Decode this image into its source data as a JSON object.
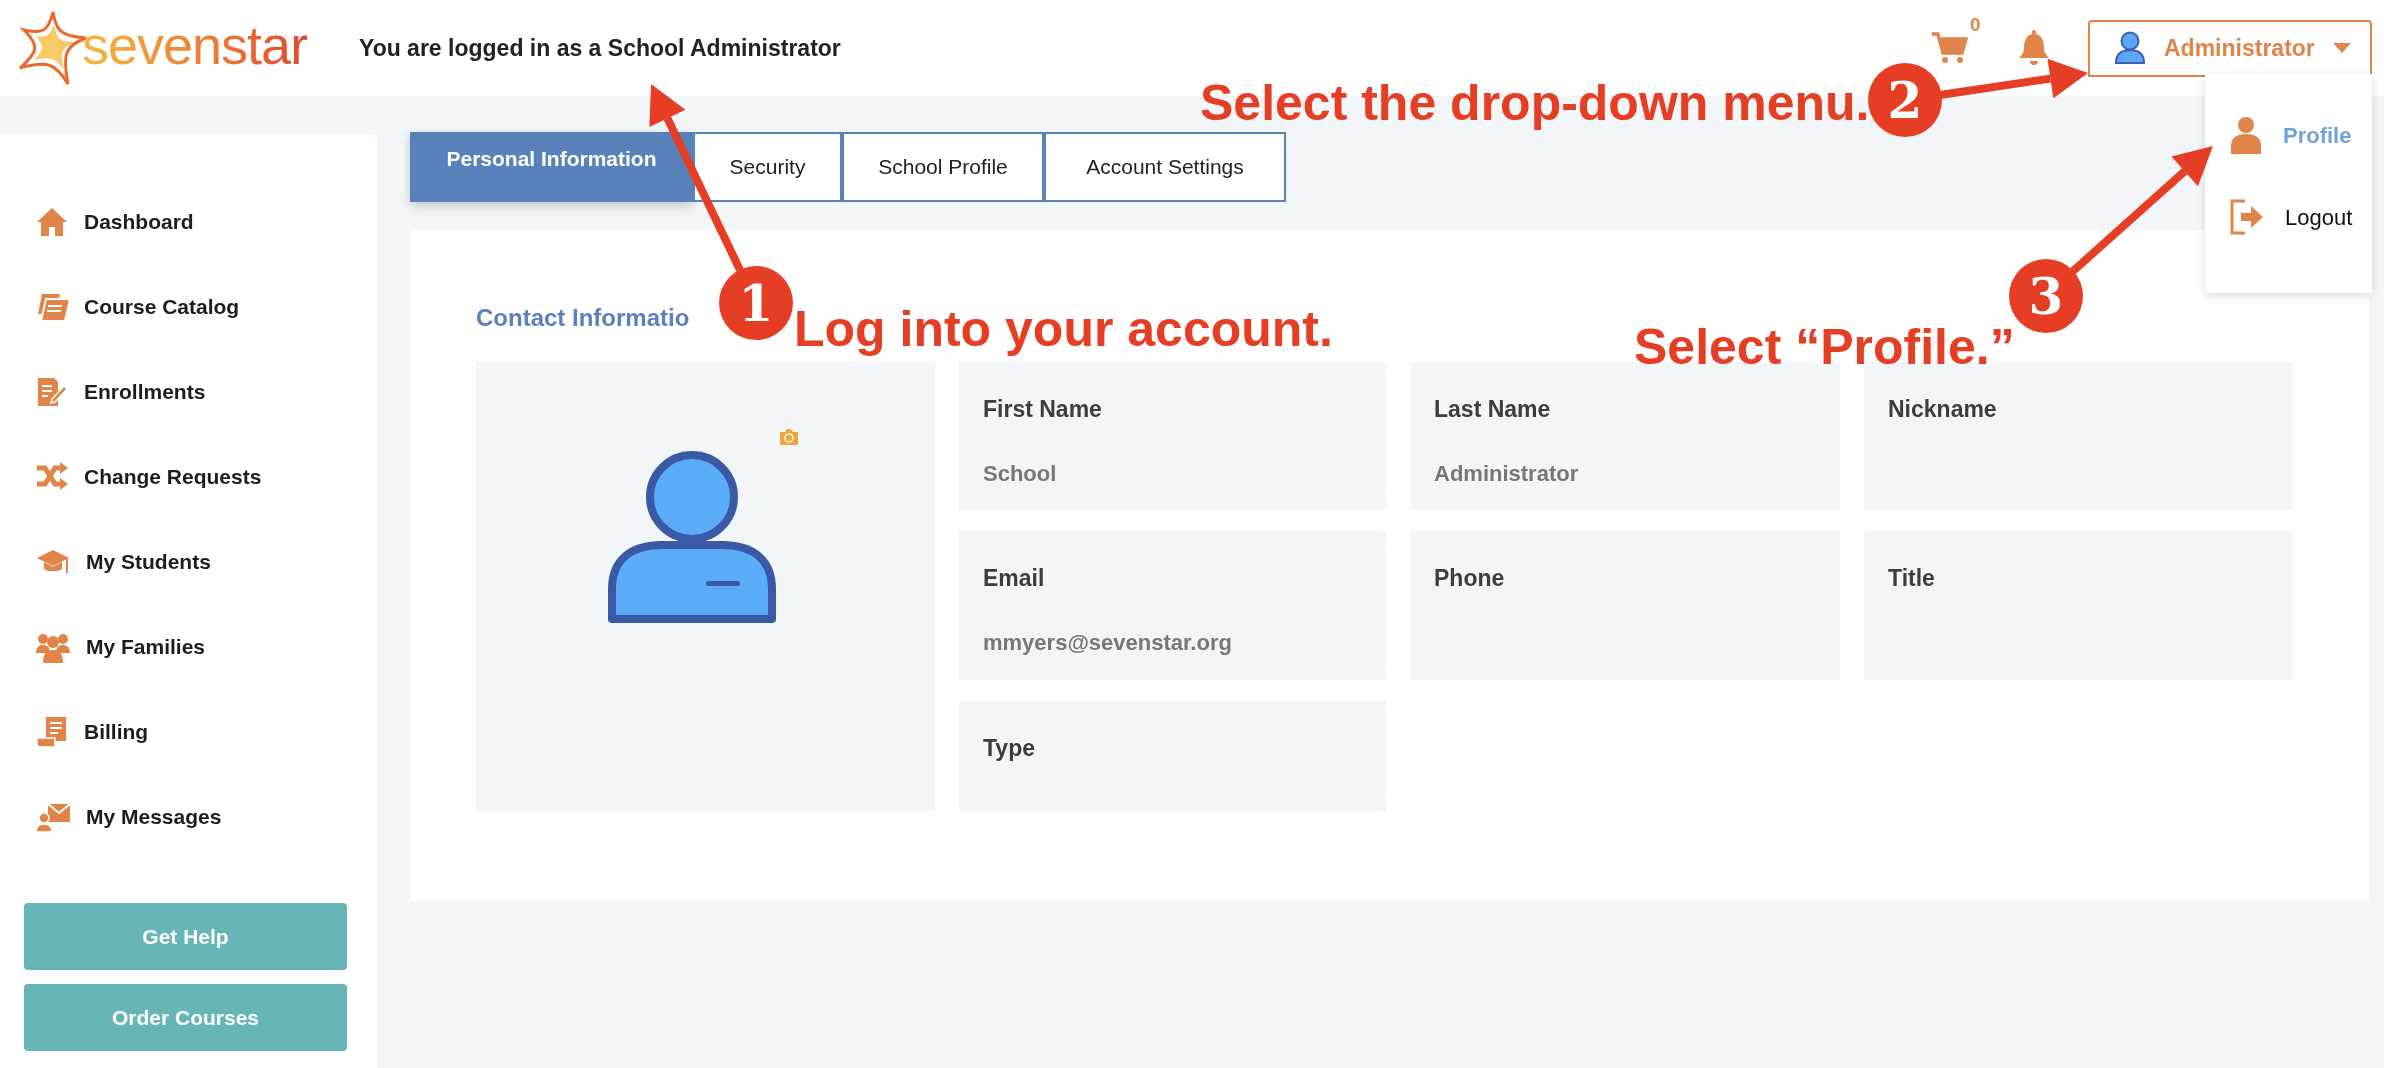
{
  "header": {
    "logo_text": "sevenstar",
    "message": "You are logged in as a School Administrator",
    "cart_count": "0",
    "user_menu": {
      "label": "Administrator",
      "expanded": true,
      "items": [
        {
          "label": "Profile",
          "selected": true
        },
        {
          "label": "Logout",
          "selected": false
        }
      ]
    }
  },
  "sidebar": {
    "items": [
      {
        "label": "Dashboard"
      },
      {
        "label": "Course Catalog"
      },
      {
        "label": "Enrollments"
      },
      {
        "label": "Change Requests"
      },
      {
        "label": "My Students"
      },
      {
        "label": "My Families"
      },
      {
        "label": "Billing"
      },
      {
        "label": "My Messages"
      }
    ],
    "buttons": [
      "Get Help",
      "Order Courses"
    ]
  },
  "tabs": [
    {
      "label": "Personal Information",
      "selected": true
    },
    {
      "label": "Security",
      "selected": false
    },
    {
      "label": "School Profile",
      "selected": false
    },
    {
      "label": "Account Settings",
      "selected": false
    }
  ],
  "section_title": "Contact Informatio",
  "fields": [
    {
      "label": "First Name",
      "value": "School"
    },
    {
      "label": "Last Name",
      "value": "Administrator"
    },
    {
      "label": "Nickname"
    },
    {
      "label": "Email",
      "value": "mmyers@sevenstar.org"
    },
    {
      "label": "Phone"
    },
    {
      "label": "Title"
    },
    {
      "label": "Type"
    }
  ],
  "annotations": [
    {
      "number": "1",
      "text": "Log into your account."
    },
    {
      "number": "2",
      "text": "Select the drop-down menu."
    },
    {
      "number": "3",
      "text": "Select “Profile.”"
    }
  ]
}
